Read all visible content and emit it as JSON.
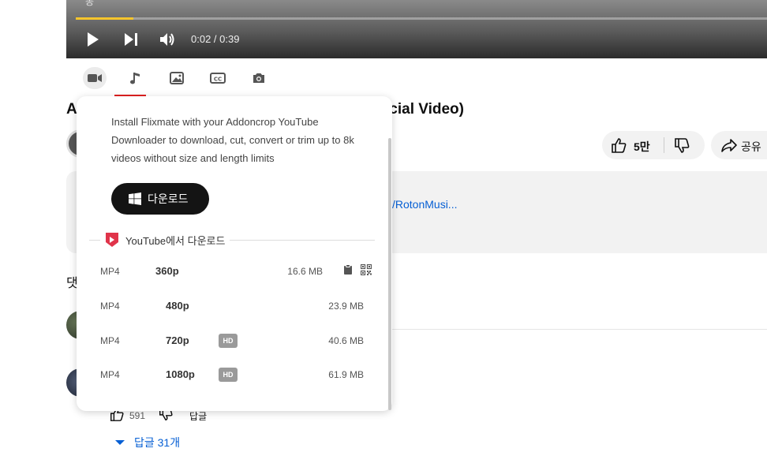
{
  "player": {
    "overlay_text": "동",
    "time": "0:02 / 0:39",
    "progress": 0.083
  },
  "toolbar": {
    "icons": [
      "video-icon",
      "music-icon",
      "image-icon",
      "cc-icon",
      "camera-icon"
    ],
    "active": "video-icon"
  },
  "video": {
    "title_start": "A",
    "title_end": "icial Video)",
    "likes": "5만",
    "share_label": "공유",
    "desc_link": "/RotonMusi..."
  },
  "comments": {
    "header": "댓",
    "like_count": "591",
    "reply_label": "답글",
    "replies_link": "답글 31개"
  },
  "popup": {
    "install_text": "Install Flixmate with your Addoncrop YouTube Downloader to download, cut, convert or trim up to 8k videos without size and length limits",
    "download_button": "다운로드",
    "section_title": "YouTube에서 다운로드",
    "rows": [
      {
        "format": "MP4",
        "resolution": "360p",
        "hd": "",
        "size": "16.6 MB"
      },
      {
        "format": "MP4",
        "resolution": "480p",
        "hd": "",
        "size": "23.9 MB"
      },
      {
        "format": "MP4",
        "resolution": "720p",
        "hd": "HD",
        "size": "40.6 MB"
      },
      {
        "format": "MP4",
        "resolution": "1080p",
        "hd": "HD",
        "size": "61.9 MB"
      }
    ]
  },
  "colors": {
    "accent_blue": "#065fd4",
    "progress_yellow": "#f7c52c",
    "brand_red": "#e02020"
  }
}
